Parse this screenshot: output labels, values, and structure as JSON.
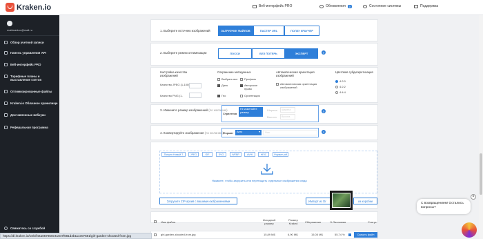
{
  "app": {
    "logo": "Kraken.io"
  },
  "topnav": {
    "web": "Веб-интерфейс PRO",
    "updates": "Обновления",
    "updates_badge": "0",
    "status": "Состояние системы",
    "support": "Поддержка"
  },
  "sidebar": {
    "email": "mattmarkov@mail.ru",
    "items": [
      {
        "label": "Обзор учетной записи",
        "icon": "user-icon"
      },
      {
        "label": "Панель управления API",
        "icon": "code-icon"
      },
      {
        "label": "Веб-интерфейс PRO",
        "icon": "monitor-icon"
      },
      {
        "label": "Тарифные планы и выставление счетов",
        "icon": "card-icon"
      },
      {
        "label": "Оптимизированные файлы",
        "icon": "files-icon"
      },
      {
        "label": "Kraken.io Облачное хранилище",
        "icon": "cloud-icon"
      },
      {
        "label": "Доставленные вебхуки",
        "icon": "webhook-icon"
      },
      {
        "label": "Реферальная программа",
        "icon": "gift-icon"
      }
    ],
    "footer": "Свяжитесь со службой"
  },
  "step1": {
    "label": "1. Выберите источник изображений",
    "tabs": [
      "ЗАГРУЗЧИК ФАЙЛОВ",
      "ПАСТЕР URL",
      "ПОЛЗУ КРАУЧЕР"
    ]
  },
  "step2": {
    "label": "2. Выберите режим оптимизации",
    "tabs": [
      "ЛОССИ",
      "БЕЗ ПОТЕРЬ",
      "ЭКСПЕРТ"
    ]
  },
  "options": {
    "quality": {
      "title": "Настройка качества изображений",
      "jpeg": "Качество JPEG (1-100)",
      "png": "Качество PNG (1-"
    },
    "metadata": {
      "title": "Сохранение метаданных",
      "select_all": "Выбрать все",
      "profile": "Профиль",
      "date": "Дата",
      "copyright": "Авторское право",
      "geo": "Гео",
      "orientation": "Ориентация"
    },
    "auto_orient": {
      "title": "Автоматическая ориентация изображений",
      "option": "Автоматическая ориентация изображений"
    },
    "chroma": {
      "title": "Цветовая субдискретизация",
      "options": [
        "4:2:0",
        "4:2:2",
        "4:4:4"
      ]
    }
  },
  "step3": {
    "label": "3. Измените размер изображений",
    "hint": "(по желанию)",
    "strategy_label": "Стратегия",
    "strategy_value": "Не изменяйте размер",
    "width": "Ширина",
    "height": "Высота",
    "width_ph": "Ширина",
    "height_ph": "Высота"
  },
  "step4": {
    "label": "4. Конвертируйте изображения",
    "hint": "(по желанию)",
    "format_label": "Формат",
    "format_value": "Авто",
    "bg": "Фон"
  },
  "formats": [
    "Популя Новый Т",
    "JPEG",
    "GIF",
    "SVG",
    "WEBP",
    "AVHI",
    "HEIC",
    "Формат pdf"
  ],
  "drop": {
    "text": "Нажмите, чтобы загрузить или перетащить отдельные изображения сюда",
    "zip": "Загрузите ZIP-архив с вашими изображениями",
    "import": "Импорт из Dr",
    "box": "из коробки"
  },
  "table": {
    "headers": [
      "Имя файла",
      "Исходный размер",
      "Размер Kraked",
      "Сбережение",
      "% Экономия",
      "Статус"
    ],
    "row": {
      "name": "girl-garden-shooted-from.jpg",
      "orig": "15,89 МБ",
      "kraked": "6,90 МБ",
      "saving": "15,05 МБ",
      "pct": "55,74 %",
      "action": "Скачать файл"
    }
  },
  "chat": {
    "text": "С возвращением! Остались вопросы?",
    "close": "×"
  },
  "statusbar": {
    "url": "https://dl.kraken.io/web/f44a057850e41847f681d2b111e07681/girl-garden-shooted-from.jpg"
  }
}
